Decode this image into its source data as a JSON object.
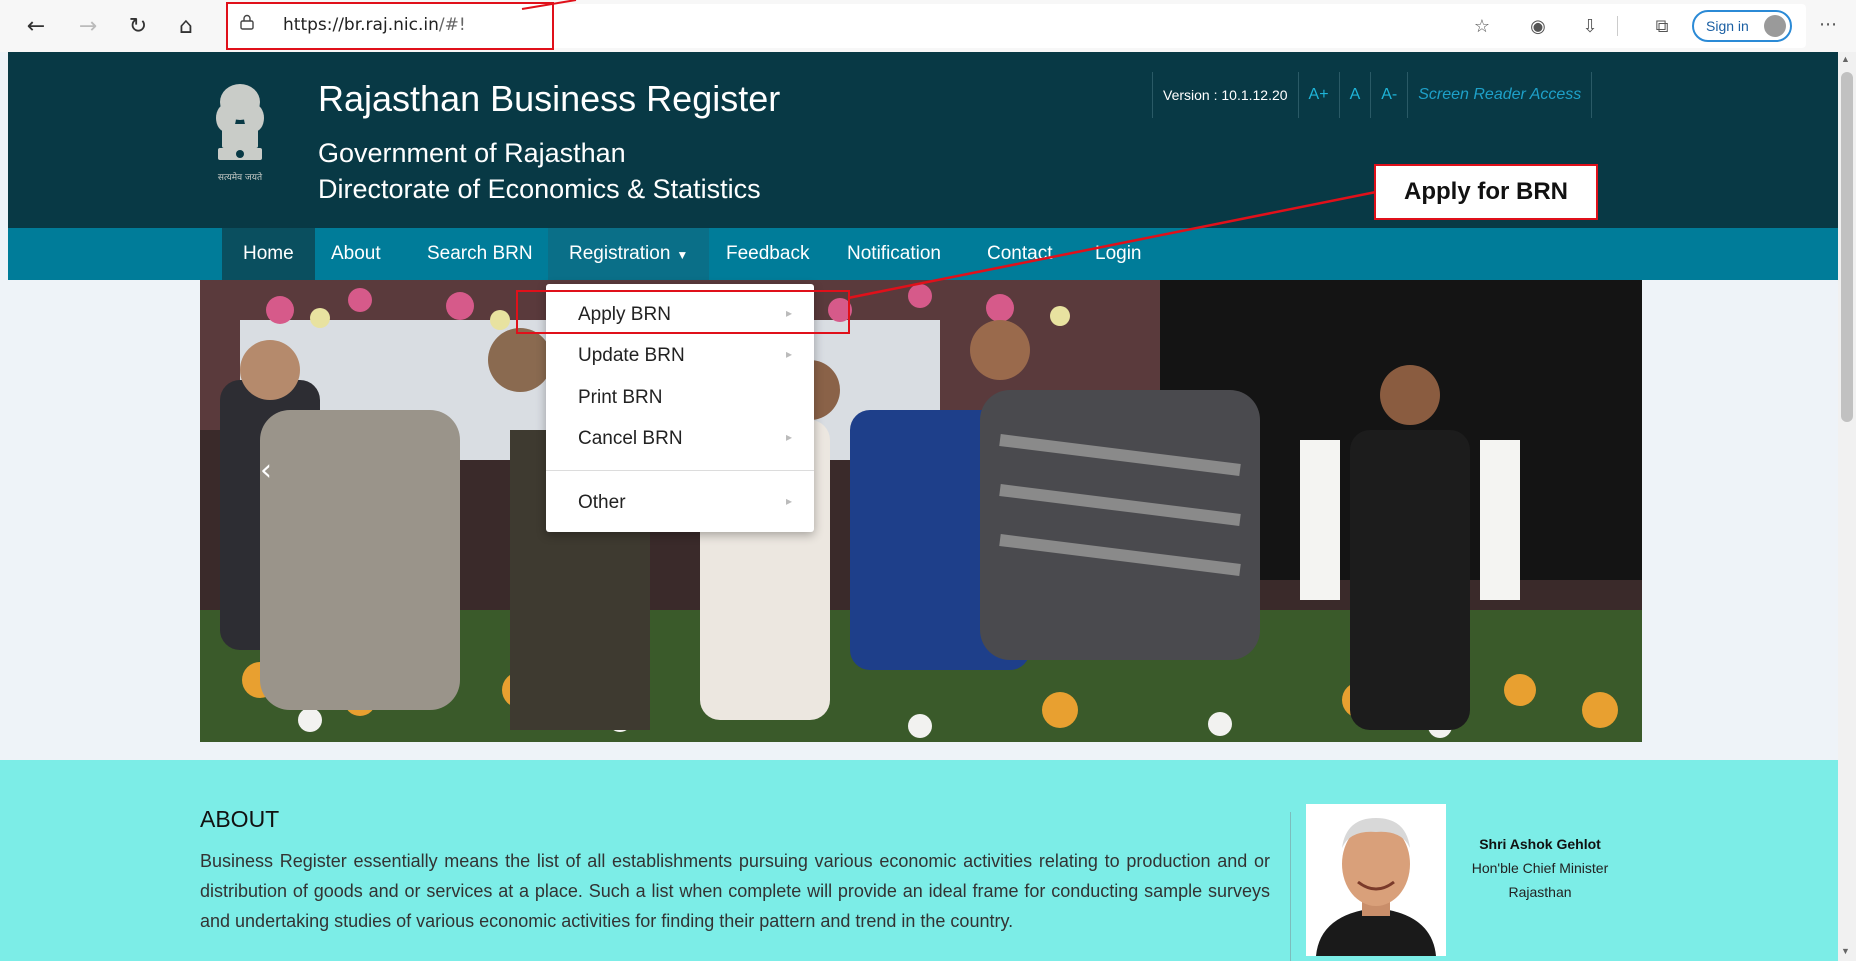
{
  "browser": {
    "url_host": "https://br.raj.nic.in",
    "url_path": "/#!",
    "signin_label": "Sign in"
  },
  "header": {
    "title": "Rajasthan Business Register",
    "subtitle1": "Government of Rajasthan",
    "subtitle2": "Directorate of Economics & Statistics",
    "emblem_caption": "सत्यमेव जयते",
    "version": "Version : 10.1.12.20",
    "font_increase": "A+",
    "font_normal": "A",
    "font_decrease": "A-",
    "screen_reader": "Screen Reader Access"
  },
  "callout": {
    "label": "Apply for BRN"
  },
  "nav": {
    "home": "Home",
    "about": "About",
    "search": "Search BRN",
    "registration": "Registration",
    "feedback": "Feedback",
    "notification": "Notification",
    "contact": "Contact",
    "login": "Login"
  },
  "dropdown": {
    "apply": "Apply BRN",
    "update": "Update BRN",
    "print": "Print BRN",
    "cancel": "Cancel BRN",
    "other": "Other"
  },
  "about": {
    "title": "ABOUT",
    "body": "Business Register essentially means the list of all establishments pursuing various economic activities relating to production and or distribution of goods and or services at a place. Such a list when complete will provide an ideal frame for conducting sample surveys and undertaking studies of various economic activities for finding their pattern and trend in the country."
  },
  "chief_minister": {
    "name": "Shri Ashok Gehlot",
    "role": "Hon'ble Chief Minister",
    "state": "Rajasthan"
  },
  "colors": {
    "header_bg": "#083945",
    "nav_bg": "#007c99",
    "about_bg": "#7cede7",
    "highlight": "#e0101a"
  }
}
